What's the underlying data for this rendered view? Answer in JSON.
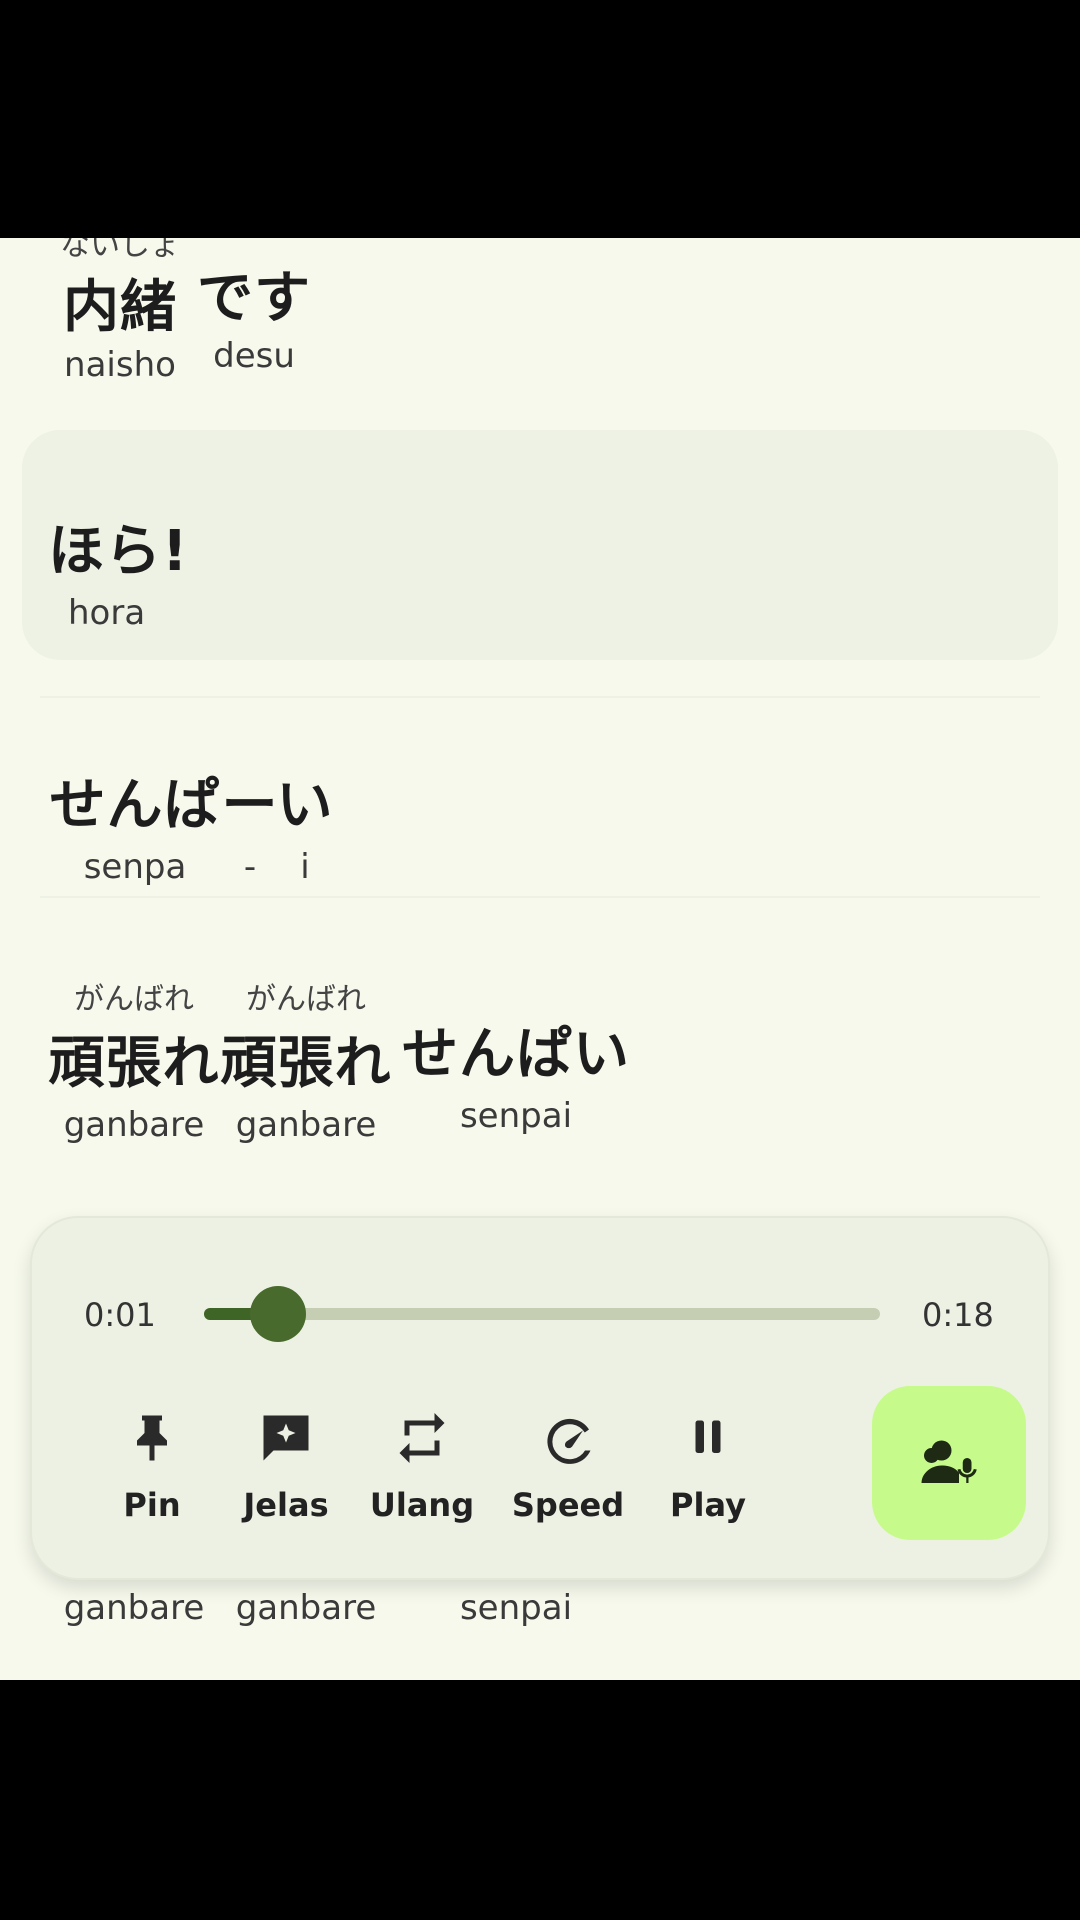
{
  "lyrics": [
    {
      "words": [
        {
          "ruby": "ないしょ",
          "text": "内緒",
          "romaji": "naisho"
        },
        {
          "ruby": "",
          "text": "です",
          "romaji": "desu"
        }
      ]
    },
    {
      "highlighted": true,
      "words": [
        {
          "ruby": "",
          "text": "ほら!",
          "romaji": "hora"
        }
      ]
    },
    {
      "words": [
        {
          "ruby": "",
          "text": "せんぱ",
          "romaji": "senpa"
        },
        {
          "ruby": "",
          "text": "ー",
          "romaji": "-"
        },
        {
          "ruby": "",
          "text": "い",
          "romaji": "i"
        }
      ]
    },
    {
      "words": [
        {
          "ruby": "がんばれ",
          "text": "頑張れ",
          "romaji": "ganbare"
        },
        {
          "ruby": "がんばれ",
          "text": "頑張れ",
          "romaji": "ganbare"
        },
        {
          "ruby": "",
          "text": "せんぱい",
          "romaji": "senpai"
        }
      ]
    },
    {
      "partial": true,
      "words": [
        {
          "romaji": "ganbare"
        },
        {
          "romaji": "ganbare"
        },
        {
          "romaji": "senpai"
        }
      ]
    }
  ],
  "player": {
    "current_time": "0:01",
    "total_time": "0:18",
    "progress": 0.11,
    "controls": [
      {
        "icon": "pin-icon",
        "label": "Pin"
      },
      {
        "icon": "explain-icon",
        "label": "Jelas"
      },
      {
        "icon": "repeat-icon",
        "label": "Ulang"
      },
      {
        "icon": "speed-icon",
        "label": "Speed"
      },
      {
        "icon": "pause-icon",
        "label": "Play"
      }
    ],
    "voice_button_icon": "voice-practice-icon",
    "accent_color": "#c6fb8c"
  }
}
